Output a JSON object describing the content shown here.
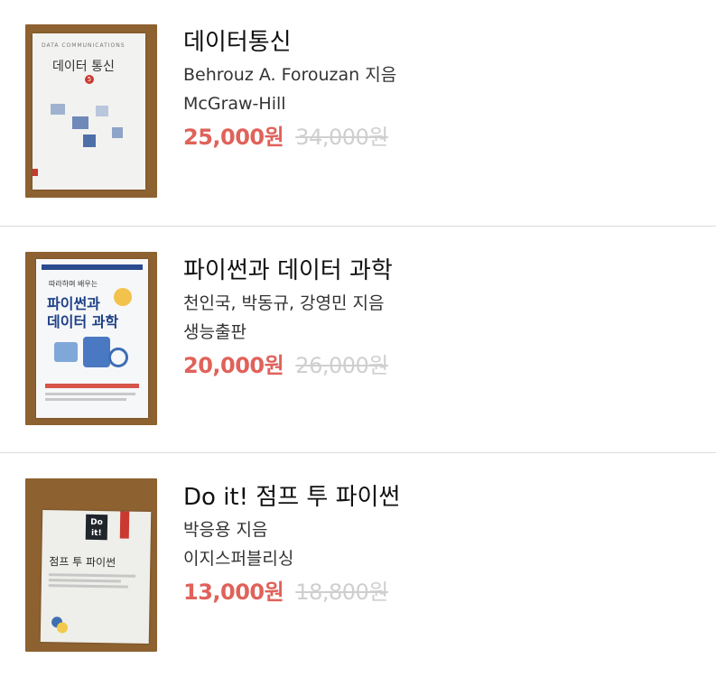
{
  "books": [
    {
      "title": "데이터통신",
      "author": "Behrouz A. Forouzan 지음",
      "publisher": "McGraw-Hill",
      "price": "25,000원",
      "original_price": "34,000원",
      "cover": {
        "top_text": "DATA COMMUNICATIONS",
        "title": "데이터 통신",
        "badge": "5"
      }
    },
    {
      "title": "파이썬과 데이터 과학",
      "author": "천인국, 박동규, 강영민 지음",
      "publisher": "생능출판",
      "price": "20,000원",
      "original_price": "26,000원",
      "cover": {
        "line1": "따라하며 배우는",
        "line2": "파이썬과",
        "line3": "데이터 과학"
      }
    },
    {
      "title": "Do it! 점프 투 파이썬",
      "author": "박응용 지음",
      "publisher": "이지스퍼블리싱",
      "price": "13,000원",
      "original_price": "18,800원",
      "cover": {
        "badge": "Do it!",
        "title": "점프 투 파이썬"
      }
    }
  ],
  "colors": {
    "price": "#e0625a",
    "original_price": "#cfcfcf",
    "divider": "#dcdcdc",
    "photo_background": "#8d6130"
  }
}
